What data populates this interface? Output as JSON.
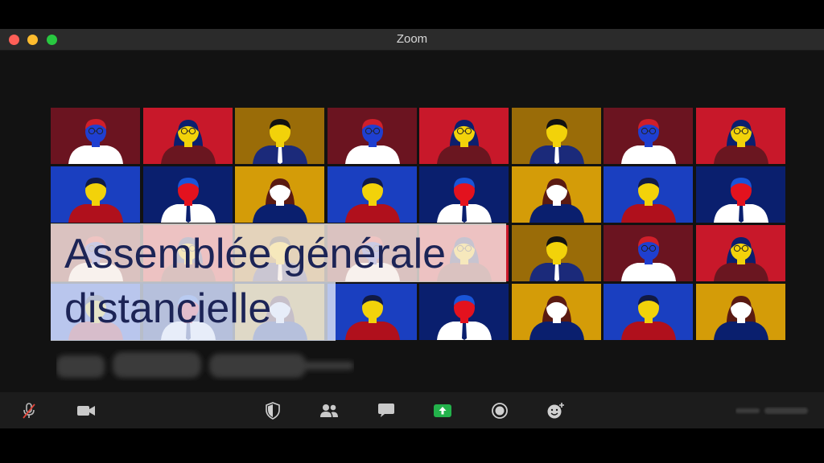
{
  "window": {
    "title": "Zoom"
  },
  "slide": {
    "title": "Assemblée générale\ndistancielle"
  },
  "participants": [
    [
      "#6b1420",
      "#c8182a",
      "#9a6c08",
      "#6b1420",
      "#c8182a",
      "#9a6c08",
      "#6b1420",
      "#c8182a"
    ],
    [
      "#1a3fc0",
      "#0a1f6e",
      "#d49c08",
      "#1a3fc0",
      "#0a1f6e",
      "#d49c08",
      "#1a3fc0",
      "#0a1f6e"
    ],
    [
      "#6b1420",
      "#c8182a",
      "#9a6c08",
      "#6b1420",
      "#c8182a",
      "#9a6c08",
      "#6b1420",
      "#c8182a"
    ],
    [
      "#1a3fc0",
      "#0a1f6e",
      "#d49c08",
      "#1a3fc0",
      "#0a1f6e",
      "#d49c08",
      "#1a3fc0",
      "#d49c08"
    ]
  ],
  "toolbar": {
    "icons": [
      "microphone-muted-icon",
      "video-camera-icon",
      "security-shield-icon",
      "participants-icon",
      "chat-icon",
      "share-screen-icon",
      "record-icon",
      "reactions-icon"
    ]
  },
  "colors": {
    "accent_green": "#23b24b",
    "title_text": "#1c2456",
    "toolbar_bg": "#1c1c1c",
    "titlebar_bg": "#2b2b2b"
  }
}
